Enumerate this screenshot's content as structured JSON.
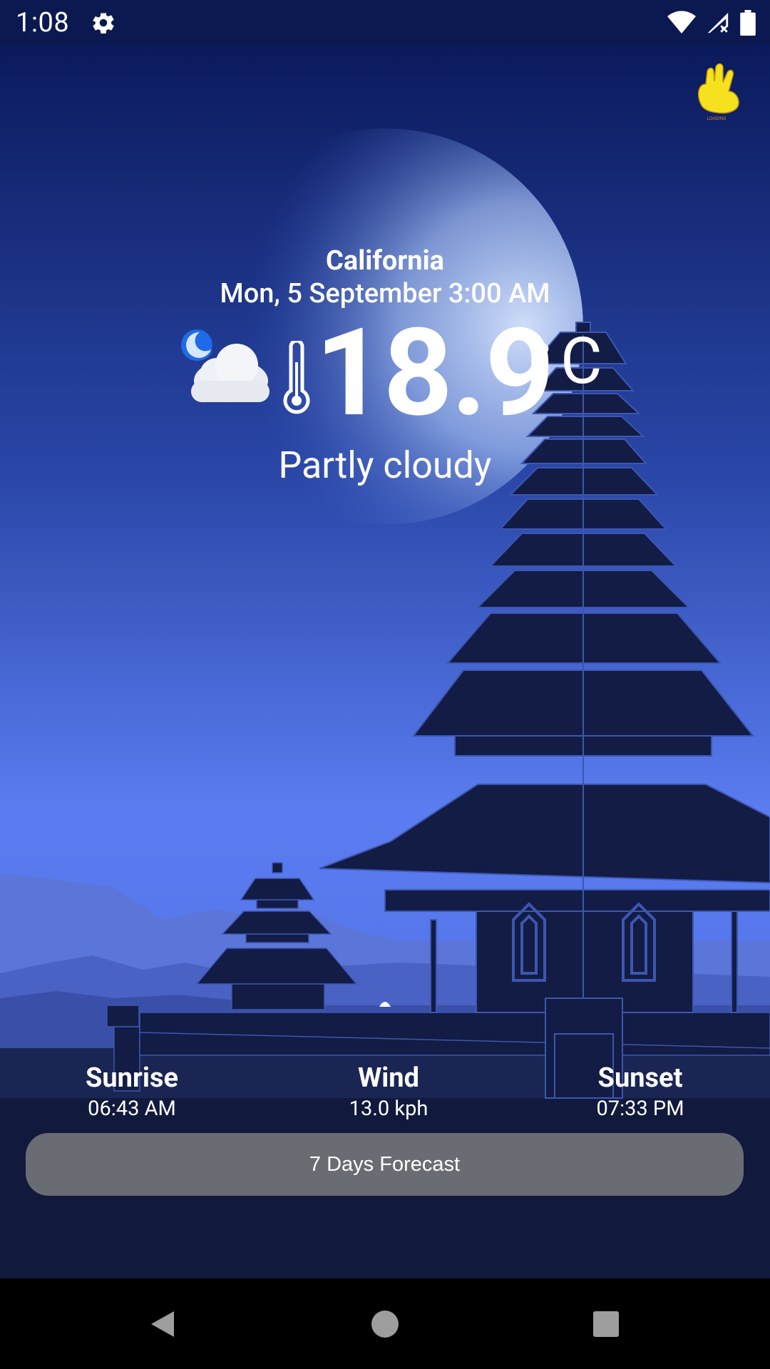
{
  "status_bar": {
    "time": "1:08",
    "icons": [
      "gear-icon",
      "wifi-icon",
      "signal-icon",
      "battery-icon"
    ]
  },
  "weather": {
    "city": "California",
    "datetime": "Mon, 5 September 3:00 AM",
    "temperature": "18.9",
    "unit_degree": "°",
    "unit_letter": "C",
    "condition": "Partly cloudy",
    "condition_icon": "moon-cloud-icon"
  },
  "stats": {
    "sunrise_label": "Sunrise",
    "sunrise_value": "06:43 AM",
    "wind_label": "Wind",
    "wind_value": "13.0 kph",
    "sunset_label": "Sunset",
    "sunset_value": "07:33 PM"
  },
  "forecast_button": "7 Days Forecast",
  "colors": {
    "sky_top": "#0b1a5c",
    "sky_bottom": "#5a7cf0",
    "silhouette": "#101a3e",
    "button_bg": "#6a6c73",
    "moon_icon": "#1e6ae8"
  },
  "nav_bar": {
    "icons": [
      "back-icon",
      "home-icon",
      "recents-icon"
    ]
  }
}
